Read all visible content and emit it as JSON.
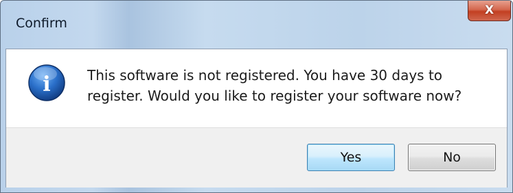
{
  "window": {
    "title": "Confirm",
    "close_icon": "x-icon",
    "close_glyph": "X"
  },
  "message": {
    "icon": "information-icon",
    "icon_glyph": "i",
    "text": "This software is not registered.  You have 30 days to\nregister.  Would you like to register your software now?"
  },
  "buttons": {
    "yes_label": "Yes",
    "no_label": "No",
    "default": "yes"
  },
  "colors": {
    "title_bar": "#bcd3ea",
    "close_button": "#c94a2c",
    "info_icon": "#1f5fb0",
    "button_area": "#f0f0f0",
    "default_button_border": "#3c7fb1"
  }
}
